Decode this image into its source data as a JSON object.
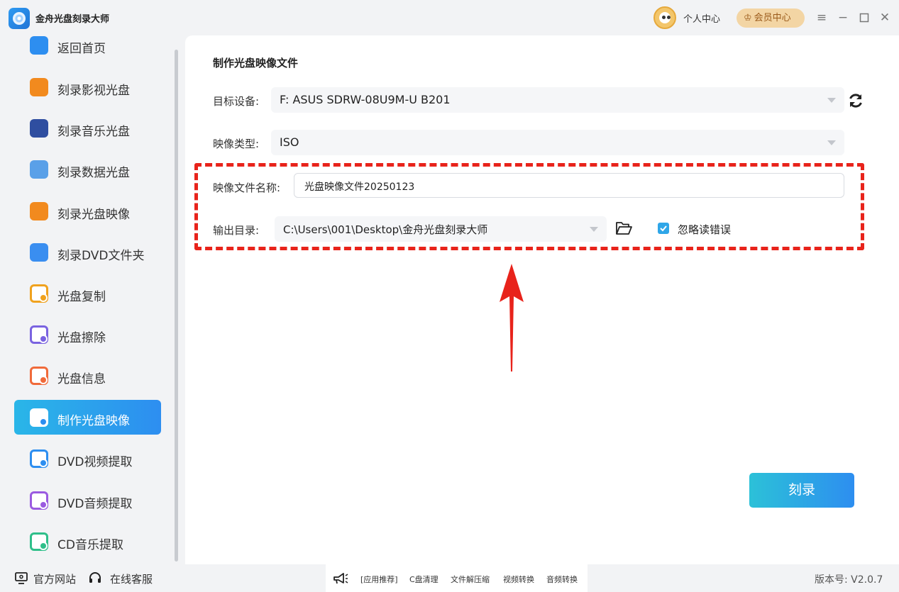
{
  "app": {
    "title": "金舟光盘刻录大师"
  },
  "header": {
    "personal_center": "个人中心",
    "vip_center": "会员中心"
  },
  "sidebar": {
    "items": [
      {
        "label": "返回首页",
        "icon": "home-icon",
        "color": "#2d8ef0"
      },
      {
        "label": "刻录影视光盘",
        "icon": "video-disc-icon",
        "color": "#f28a1e"
      },
      {
        "label": "刻录音乐光盘",
        "icon": "music-disc-icon",
        "color": "#2f4ea0"
      },
      {
        "label": "刻录数据光盘",
        "icon": "data-disc-icon",
        "color": "#5aa0e8"
      },
      {
        "label": "刻录光盘映像",
        "icon": "disc-image-icon",
        "color": "#f28a1e"
      },
      {
        "label": "刻录DVD文件夹",
        "icon": "dvd-folder-icon",
        "color": "#3a8ef0"
      },
      {
        "label": "光盘复制",
        "icon": "disc-copy-icon",
        "color": "#f0a21e"
      },
      {
        "label": "光盘擦除",
        "icon": "disc-erase-icon",
        "color": "#7a63e0"
      },
      {
        "label": "光盘信息",
        "icon": "disc-info-icon",
        "color": "#f06a3a"
      },
      {
        "label": "制作光盘映像",
        "icon": "make-disc-image-icon",
        "color": "#2d8ef0"
      },
      {
        "label": "DVD视频提取",
        "icon": "dvd-video-extract-icon",
        "color": "#2d8ef0"
      },
      {
        "label": "DVD音频提取",
        "icon": "dvd-audio-extract-icon",
        "color": "#9a5ae0"
      },
      {
        "label": "CD音乐提取",
        "icon": "cd-music-extract-icon",
        "color": "#2fbf8a"
      }
    ],
    "active_index": 9
  },
  "main": {
    "title": "制作光盘映像文件",
    "target_device": {
      "label": "目标设备:",
      "value": "F: ASUS SDRW-08U9M-U B201"
    },
    "image_type": {
      "label": "映像类型:",
      "value": "ISO"
    },
    "image_name": {
      "label": "映像文件名称:",
      "value": "光盘映像文件20250123"
    },
    "output_dir": {
      "label": "输出目录:",
      "value": "C:\\Users\\001\\Desktop\\金舟光盘刻录大师"
    },
    "ignore_errors": {
      "label": "忽略读错误",
      "checked": true
    },
    "burn_button": "刻录"
  },
  "footer": {
    "website": "官方网站",
    "support": "在线客服",
    "promo": [
      "[应用推荐]",
      "C盘清理",
      "文件解压缩",
      "视频转换",
      "音频转换"
    ],
    "version": "版本号: V2.0.7"
  },
  "colors": {
    "accent": "#2d8ef0",
    "highlight_border": "#e8231b",
    "arrow": "#e8231b"
  }
}
